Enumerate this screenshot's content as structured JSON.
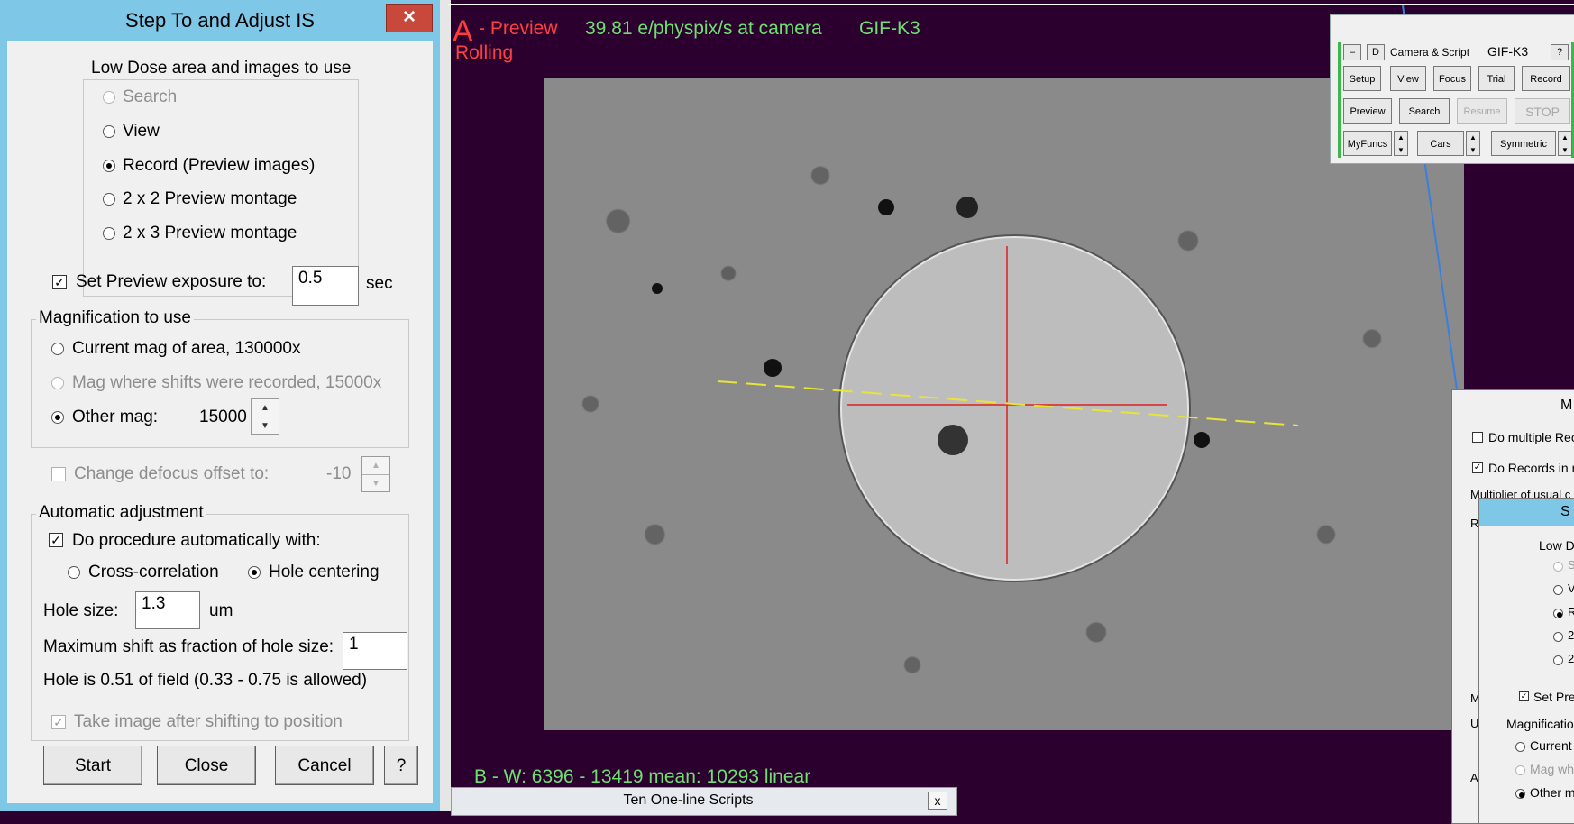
{
  "dialog": {
    "title": "Step To and Adjust IS",
    "close_glyph": "×",
    "low_dose_group": "Low Dose area and images to use",
    "low_dose_options": [
      "Search",
      "View",
      "Record (Preview images)",
      "2 x 2 Preview montage",
      "2 x 3 Preview montage"
    ],
    "low_dose_selected": 2,
    "set_preview_label": "Set Preview exposure to:",
    "set_preview_checked": true,
    "preview_exposure": "0.5",
    "preview_unit": "sec",
    "mag_group": "Magnification to use",
    "mag_options": [
      "Current mag of area, 130000x",
      "Mag where shifts were recorded, 15000x",
      "Other mag:"
    ],
    "mag_selected": 2,
    "other_mag_value": "15000",
    "defocus_label": "Change defocus offset to:",
    "defocus_value": "-10",
    "auto_group": "Automatic adjustment",
    "auto_label": "Do procedure automatically with:",
    "auto_checked": true,
    "method_options": [
      "Cross-correlation",
      "Hole centering"
    ],
    "method_selected": 1,
    "hole_size_label": "Hole size:",
    "hole_size_value": "1.3",
    "hole_size_unit": "um",
    "max_shift_label": "Maximum shift as fraction of hole size:",
    "max_shift_value": "1",
    "hole_info": "Hole is 0.51 of field (0.33 - 0.75 is allowed)",
    "take_image_label": "Take image after shifting to position",
    "take_image_checked": true,
    "buttons": {
      "start": "Start",
      "close": "Close",
      "cancel": "Cancel",
      "help": "?"
    }
  },
  "image_panel": {
    "buffer_letter": "A",
    "buffer_desc": "- Preview",
    "rolling": "Rolling",
    "dose_rate": "39.81 e/physpix/s at camera",
    "camera": "GIF-K3",
    "bottom_info": "B - W: 6396 - 13419  mean: 10293  linear"
  },
  "camera_panel": {
    "minus": "–",
    "d": "D",
    "title": "Camera & Script",
    "camera": "GIF-K3",
    "help": "?",
    "row1": [
      "Setup",
      "View",
      "Focus",
      "Trial",
      "Record"
    ],
    "row2": [
      "Preview",
      "Search",
      "Resume",
      "STOP"
    ],
    "row3": [
      "MyFuncs",
      "Cars",
      "Symmetric"
    ]
  },
  "right_partial": {
    "m_title": "M",
    "do_multiple": "Do multiple Rec",
    "do_records": "Do Records in n",
    "multiplier": "Multiplier of usual c",
    "r1": "R",
    "s_title": "S",
    "low_d": "Low D",
    "opts": [
      "S",
      "V",
      "R",
      "2",
      "2"
    ],
    "set_pre": "Set Pre",
    "magnification": "Magnificatio",
    "current": "Current",
    "mag_wh": "Mag wh",
    "other_m": "Other m",
    "side_letters": [
      "M",
      "U",
      "A"
    ]
  },
  "bottom_window": {
    "title": "Ten One-line Scripts",
    "close": "x"
  },
  "colors": {
    "accent_red": "#ff4040",
    "accent_green": "#6fe06f",
    "background": "#2b002f"
  }
}
